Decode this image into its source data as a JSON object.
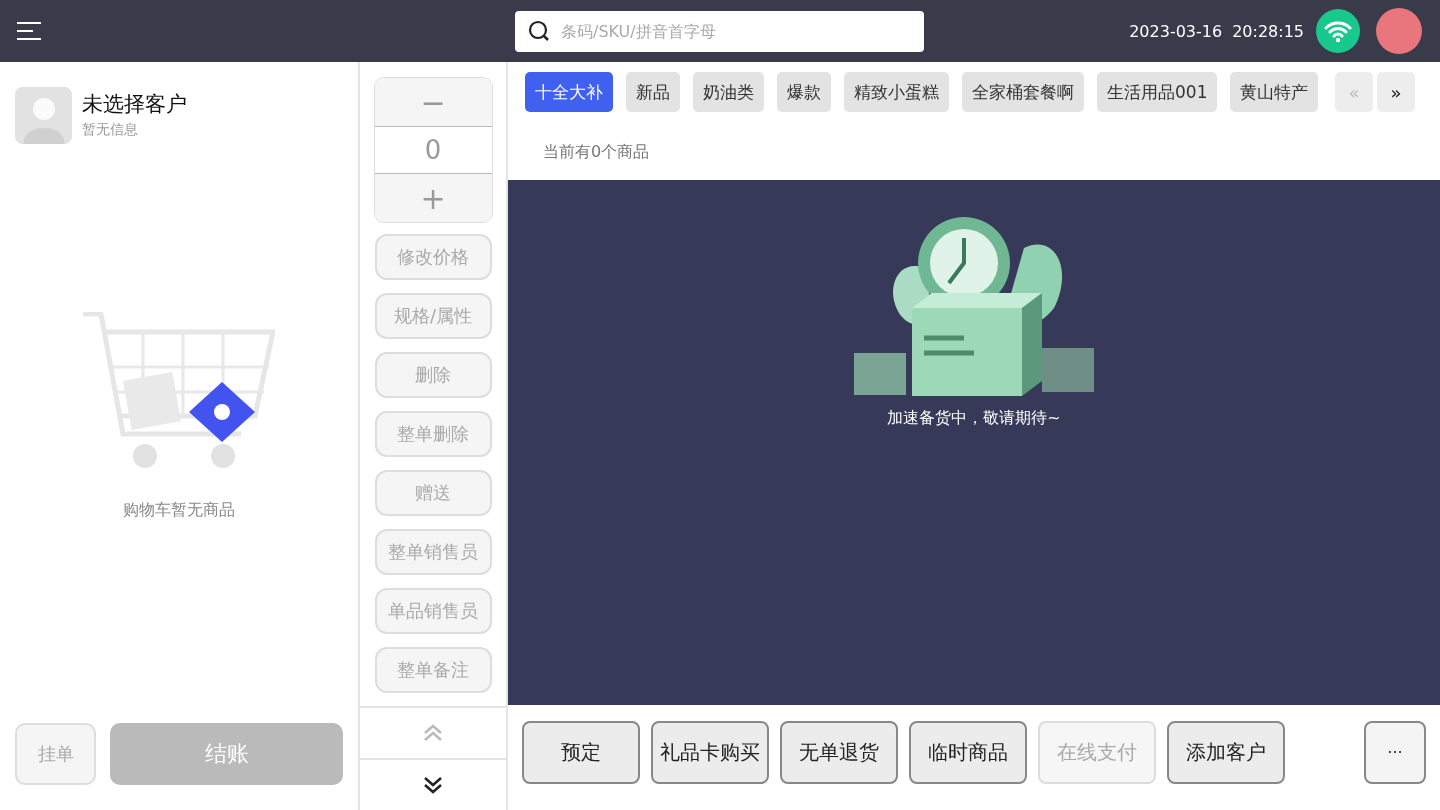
{
  "header": {
    "search": {
      "placeholder": "条码/SKU/拼音首字母"
    },
    "date": "2023-03-16",
    "time": "20:28:15"
  },
  "customer": {
    "name": "未选择客户",
    "info": "暂无信息"
  },
  "cart": {
    "empty_text": "购物车暂无商品"
  },
  "left_buttons": [
    {
      "label": "挂单",
      "kind": "secondary",
      "disabled": true
    },
    {
      "label": "结账",
      "kind": "primary",
      "disabled": true
    }
  ],
  "quantity": {
    "minus": "−",
    "value": "0",
    "plus": "+"
  },
  "actions": [
    {
      "label": "修改价格",
      "disabled": true
    },
    {
      "label": "规格/属性",
      "disabled": true
    },
    {
      "label": "删除",
      "disabled": true
    },
    {
      "label": "整单删除",
      "disabled": true
    },
    {
      "label": "赠送",
      "disabled": true
    },
    {
      "label": "整单销售员",
      "disabled": true
    },
    {
      "label": "单品销售员",
      "disabled": true
    },
    {
      "label": "整单备注",
      "disabled": true
    }
  ],
  "categories": [
    {
      "label": "十全大补",
      "selected": true
    },
    {
      "label": "新品",
      "selected": false
    },
    {
      "label": "奶油类",
      "selected": false
    },
    {
      "label": "爆款",
      "selected": false
    },
    {
      "label": "精致小蛋糕",
      "selected": false
    },
    {
      "label": "全家桶套餐啊",
      "selected": false
    },
    {
      "label": "生活用品001",
      "selected": false
    },
    {
      "label": "黄山特产",
      "selected": false
    }
  ],
  "pager": [
    {
      "label": "«",
      "disabled": true
    },
    {
      "label": "»",
      "disabled": false
    }
  ],
  "product_count": "当前有0个商品",
  "empty_products": "加速备货中，敬请期待~",
  "bottom_buttons": [
    {
      "label": "预定",
      "disabled": false
    },
    {
      "label": "礼品卡购买",
      "disabled": false
    },
    {
      "label": "无单退货",
      "disabled": false
    },
    {
      "label": "临时商品",
      "disabled": false
    },
    {
      "label": "在线支付",
      "disabled": true
    },
    {
      "label": "添加客户",
      "disabled": false
    }
  ],
  "more_button": "···"
}
